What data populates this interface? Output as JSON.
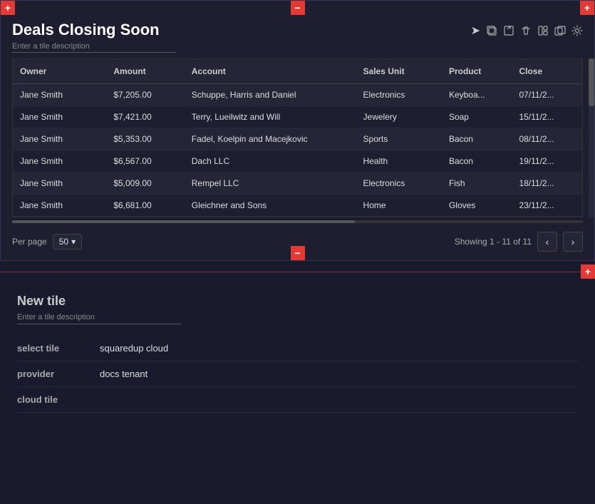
{
  "widget": {
    "title": "Deals Closing Soon",
    "description": "Enter a tile description",
    "toolbar": {
      "cursor_icon": "➤",
      "copy_icon": "⧉",
      "export_icon": "⊡",
      "delete_icon": "🗑",
      "layout_icon": "⊞",
      "duplicate_icon": "⧉",
      "settings_icon": "⚙"
    },
    "table": {
      "columns": [
        "Owner",
        "Amount",
        "Account",
        "Sales Unit",
        "Product",
        "Close"
      ],
      "rows": [
        {
          "owner": "Jane Smith",
          "amount": "$7,205.00",
          "account": "Schuppe, Harris and Daniel",
          "sales_unit": "Electronics",
          "product": "Keyboa...",
          "close": "07/11/2..."
        },
        {
          "owner": "Jane Smith",
          "amount": "$7,421.00",
          "account": "Terry, Lueilwitz and Will",
          "sales_unit": "Jewelery",
          "product": "Soap",
          "close": "15/11/2..."
        },
        {
          "owner": "Jane Smith",
          "amount": "$5,353.00",
          "account": "Fadel, Koelpin and Macejkovic",
          "sales_unit": "Sports",
          "product": "Bacon",
          "close": "08/11/2..."
        },
        {
          "owner": "Jane Smith",
          "amount": "$6,567.00",
          "account": "Dach LLC",
          "sales_unit": "Health",
          "product": "Bacon",
          "close": "19/11/2..."
        },
        {
          "owner": "Jane Smith",
          "amount": "$5,009.00",
          "account": "Rempel LLC",
          "sales_unit": "Electronics",
          "product": "Fish",
          "close": "18/11/2..."
        },
        {
          "owner": "Jane Smith",
          "amount": "$6,681.00",
          "account": "Gleichner and Sons",
          "sales_unit": "Home",
          "product": "Gloves",
          "close": "23/11/2..."
        }
      ]
    },
    "pagination": {
      "per_page_label": "Per page",
      "per_page_value": "50",
      "showing_text": "Showing 1 - 11 of 11",
      "prev_icon": "‹",
      "next_icon": "›"
    }
  },
  "add_buttons": {
    "plus": "+",
    "minus": "−"
  },
  "new_tile": {
    "title": "New tile",
    "description": "Enter a tile description",
    "select_tile_label": "select tile",
    "select_tile_value": "squaredup cloud",
    "provider_label": "provider",
    "provider_value": "docs tenant",
    "cloud_tile_label": "cloud tile"
  }
}
